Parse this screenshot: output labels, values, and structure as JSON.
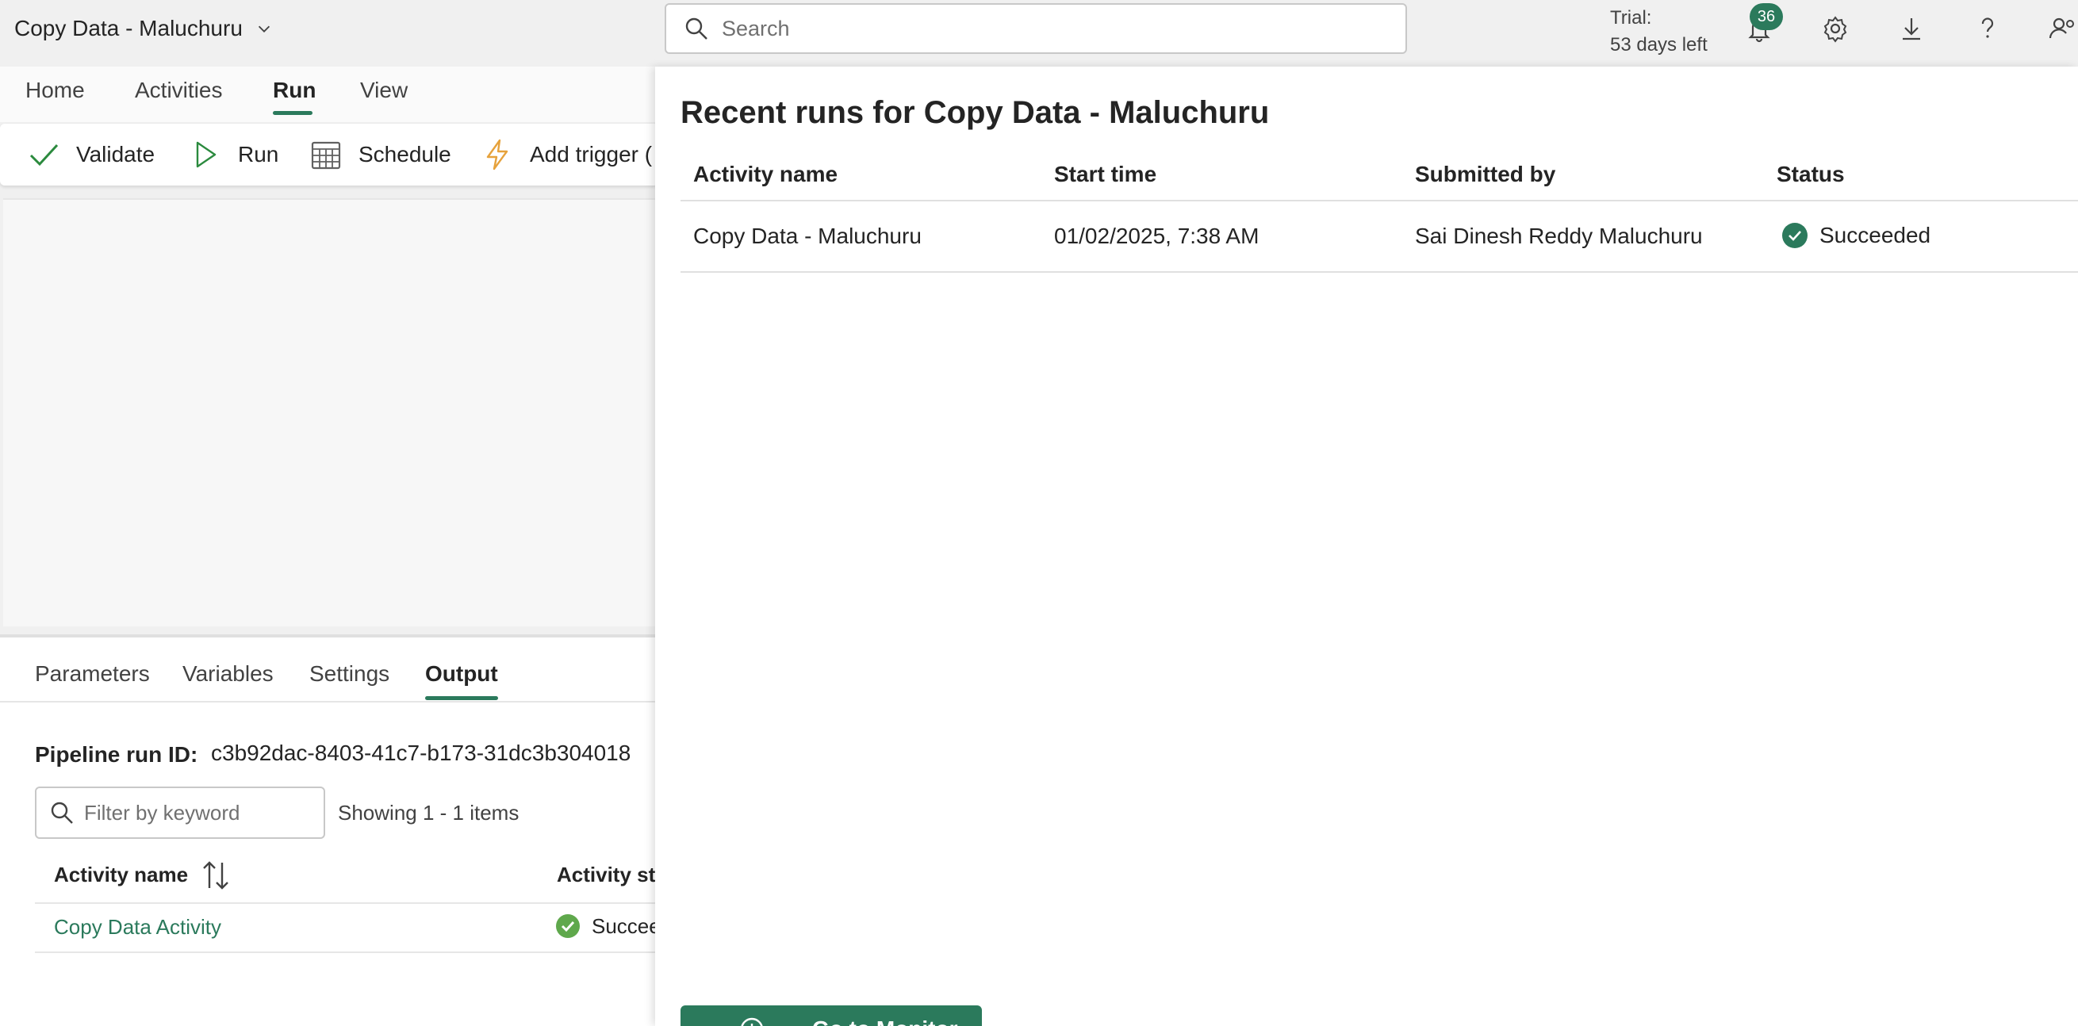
{
  "header": {
    "title": "Copy Data - Maluchuru",
    "search_placeholder": "Search",
    "trial_label": "Trial:",
    "trial_days": "53 days left",
    "notification_count": "36"
  },
  "ribbon": {
    "tabs": [
      "Home",
      "Activities",
      "Run",
      "View"
    ],
    "active_tab": "Run",
    "buttons": {
      "validate": "Validate",
      "run": "Run",
      "schedule": "Schedule",
      "add_trigger": "Add trigger ("
    }
  },
  "bottom_panel": {
    "tabs": [
      "Parameters",
      "Variables",
      "Settings",
      "Output"
    ],
    "active_tab": "Output",
    "run_id_label": "Pipeline run ID:",
    "run_id_value": "c3b92dac-8403-41c7-b173-31dc3b304018",
    "filter_placeholder": "Filter by keyword",
    "showing": "Showing 1 - 1 items",
    "columns": [
      "Activity name",
      "Activity sta"
    ],
    "rows": [
      {
        "activity_name": "Copy Data Activity",
        "status": "Succee"
      }
    ]
  },
  "recent_runs": {
    "title": "Recent runs for Copy Data - Maluchuru",
    "columns": [
      "Activity name",
      "Start time",
      "Submitted by",
      "Status"
    ],
    "rows": [
      {
        "activity_name": "Copy Data - Maluchuru",
        "start_time": "01/02/2025, 7:38 AM",
        "submitted_by": "Sai Dinesh Reddy Maluchuru",
        "status": "Succeeded"
      }
    ],
    "go_to_monitor": "Go to Monitor"
  },
  "colors": {
    "accent": "#2b7a5c",
    "success": "#107c41",
    "trigger": "#e6a23c"
  }
}
